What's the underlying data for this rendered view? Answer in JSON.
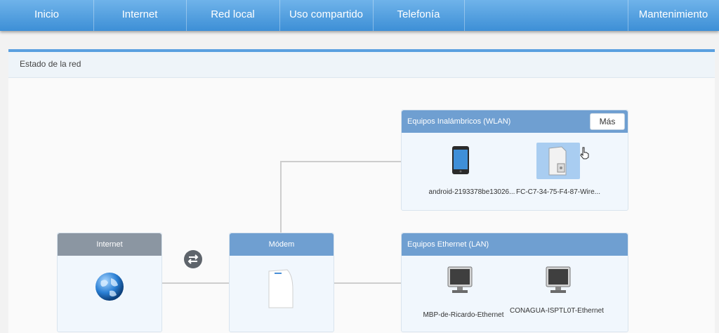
{
  "nav": {
    "items": [
      "Inicio",
      "Internet",
      "Red local",
      "Uso compartido",
      "Telefonía",
      "",
      "Mantenimiento"
    ]
  },
  "panel": {
    "title": "Estado de la red"
  },
  "internet_box": {
    "title": "Internet",
    "icon": "globe-icon"
  },
  "modem_box": {
    "title": "Módem",
    "icon": "router-icon"
  },
  "wlan_box": {
    "title": "Equipos Inalámbricos (WLAN)",
    "more_label": "Más",
    "devices": [
      {
        "label": "android-2193378be13026...",
        "icon": "smartphone-icon",
        "selected": false
      },
      {
        "label": "FC-C7-34-75-F4-87-Wire...",
        "icon": "desktop-tower-icon",
        "selected": true
      }
    ]
  },
  "lan_box": {
    "title": "Equipos Ethernet (LAN)",
    "devices": [
      {
        "label": "MBP-de-Ricardo-Ethernet",
        "icon": "monitor-icon"
      },
      {
        "label": "CONAGUA-ISPTL0T-Ethernet",
        "icon": "monitor-icon"
      }
    ]
  },
  "colors": {
    "nav": "#3d8fd6",
    "box_header": "#6f9fd1",
    "internet_header": "#8b96a2",
    "panel_accent": "#5aa0e0"
  }
}
